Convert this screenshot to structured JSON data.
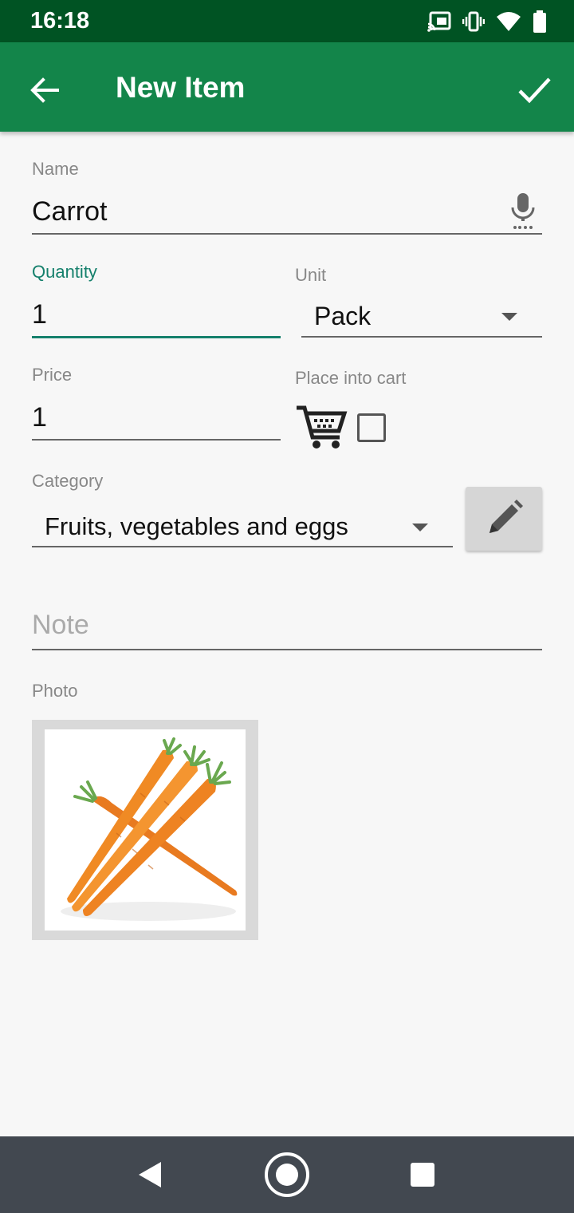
{
  "status_bar": {
    "time": "16:18"
  },
  "app_bar": {
    "title": "New Item"
  },
  "form": {
    "name": {
      "label": "Name",
      "value": "Carrot"
    },
    "quantity": {
      "label": "Quantity",
      "value": "1"
    },
    "unit": {
      "label": "Unit",
      "value": "Pack"
    },
    "price": {
      "label": "Price",
      "value": "1"
    },
    "place_into_cart": {
      "label": "Place into cart",
      "checked": false
    },
    "category": {
      "label": "Category",
      "value": "Fruits, vegetables and eggs"
    },
    "note": {
      "placeholder": "Note",
      "value": ""
    },
    "photo": {
      "label": "Photo",
      "alt": "carrots"
    }
  },
  "colors": {
    "status_bar": "#005323",
    "app_bar": "#13854a",
    "accent": "#15806c",
    "nav_bar": "#424850"
  },
  "icons": [
    "cast-icon",
    "vibrate-icon",
    "wifi-icon",
    "battery-icon",
    "back-arrow-icon",
    "check-icon",
    "microphone-icon",
    "cart-icon",
    "pencil-icon",
    "nav-back-icon",
    "nav-home-icon",
    "nav-recents-icon"
  ]
}
